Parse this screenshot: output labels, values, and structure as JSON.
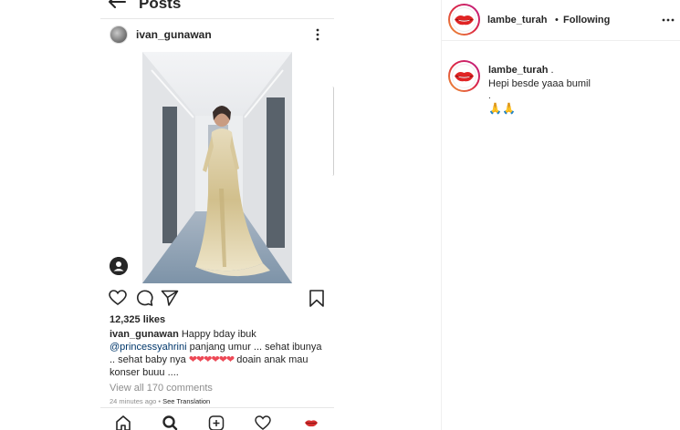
{
  "post_screenshot": {
    "header_title": "Posts",
    "username": "ivan_gunawan",
    "likes": "12,325 likes",
    "caption": {
      "username": "ivan_gunawan",
      "text_1": "Happy bday ibuk",
      "mention": "@princessyahrini",
      "text_2": "panjang umur ... sehat ibunya .. sehat baby nya",
      "hearts": "❤❤❤❤❤❤",
      "text_3": "doain anak mau konser buuu ...."
    },
    "view_comments": "View all 170 comments",
    "time_ago": "24 minutes ago",
    "see_translation": "See Translation"
  },
  "panel": {
    "header": {
      "username": "lambe_turah",
      "separator": "•",
      "follow_status": "Following"
    },
    "comment": {
      "username": "lambe_turah",
      "username_suffix": ".",
      "line_1": "Hepi besde yaaa bumil",
      "line_2": ".",
      "emoji": "🙏🙏"
    }
  },
  "colors": {
    "text": "#262626",
    "secondary": "#8e8e8e",
    "heart_red": "#ed4956",
    "mention_blue": "#00376b",
    "story_ring": "#dc2743",
    "divider": "#efefef"
  },
  "icons": {
    "back": "arrow-left-icon",
    "more": "vertical-dots-icon",
    "tag": "person-tag-icon",
    "like": "heart-icon",
    "comment": "comment-bubble-icon",
    "share": "paper-plane-icon",
    "save": "bookmark-icon",
    "nav": [
      "home-icon",
      "search-icon",
      "plus-square-icon",
      "heart-icon",
      "profile-lips-icon"
    ],
    "panel_more": "horizontal-dots-icon"
  }
}
